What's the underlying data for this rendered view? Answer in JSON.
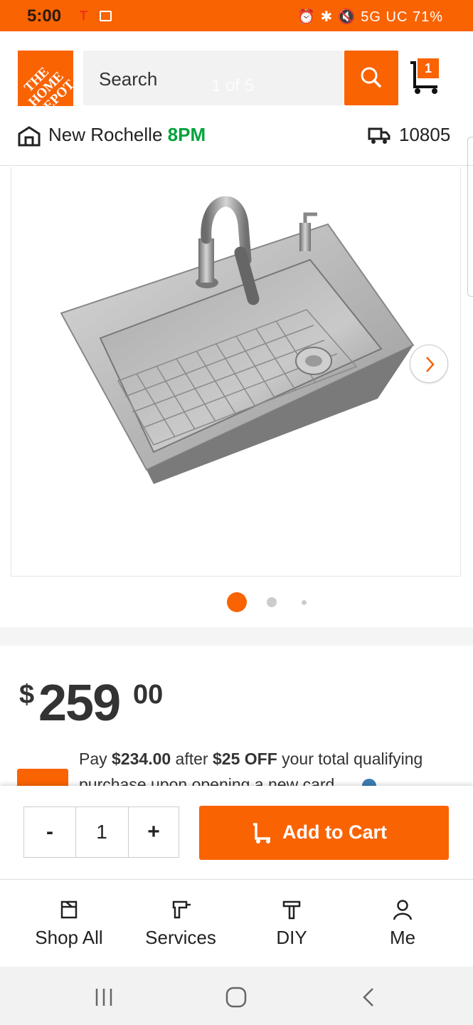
{
  "status_bar": {
    "time": "5:00",
    "network": "5G UC",
    "battery": "71%"
  },
  "header": {
    "logo_text": "THE HOME DEPOT",
    "search_placeholder": "Search",
    "gallery_counter": "1 of 5",
    "cart_count": "1"
  },
  "store": {
    "name": "New Rochelle",
    "hours": "8PM",
    "zip": "10805"
  },
  "gallery": {
    "active_index": 1,
    "total_dots": 3
  },
  "price": {
    "currency": "$",
    "dollars": "259",
    "cents": "00"
  },
  "promo": {
    "prefix": "Pay ",
    "amount": "$234.00",
    "middle": " after ",
    "discount": "$25 OFF",
    "suffix": " your total qualifying purchase upon opening a new card."
  },
  "add_to_cart": {
    "minus_label": "-",
    "quantity": "1",
    "plus_label": "+",
    "button_label": "Add to Cart"
  },
  "bottom_nav": {
    "items": [
      {
        "label": "Shop All",
        "icon": "shop-all-icon"
      },
      {
        "label": "Services",
        "icon": "drill-icon"
      },
      {
        "label": "DIY",
        "icon": "hammer-icon"
      },
      {
        "label": "Me",
        "icon": "person-icon"
      }
    ]
  },
  "colors": {
    "brand": "#f96302",
    "store_hours": "#00a33a",
    "info": "#3e7cb1"
  }
}
